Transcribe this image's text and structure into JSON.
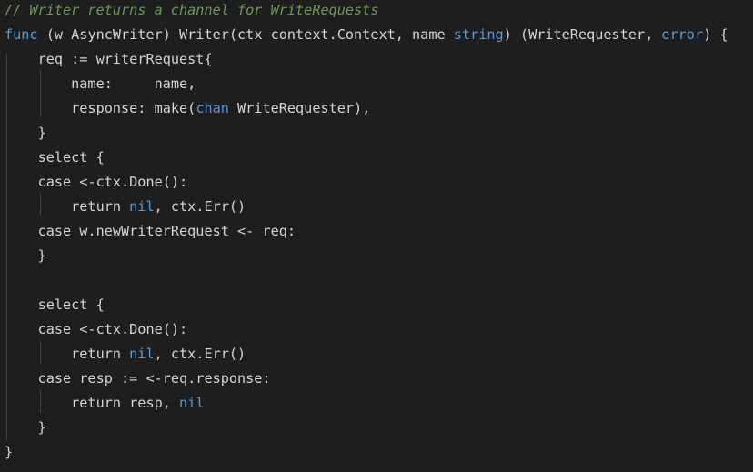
{
  "editor": {
    "language": "go",
    "colors": {
      "background": "#1e1e1e",
      "text": "#d4d4d4",
      "keyword": "#569cd6",
      "comment": "#6a9955",
      "indent_guide": "#404040"
    },
    "lines": [
      [
        {
          "t": "// Writer returns a channel for WriteRequests",
          "k": "comment"
        }
      ],
      [
        {
          "t": "func",
          "k": "keyword"
        },
        {
          "t": " (w AsyncWriter) Writer(ctx context.Context, name ",
          "k": "plain"
        },
        {
          "t": "string",
          "k": "builtin"
        },
        {
          "t": ") (WriteRequester, ",
          "k": "plain"
        },
        {
          "t": "error",
          "k": "builtin"
        },
        {
          "t": ") {",
          "k": "plain"
        }
      ],
      [
        {
          "t": "    req := writerRequest{",
          "k": "plain"
        }
      ],
      [
        {
          "t": "        name:     name,",
          "k": "plain"
        }
      ],
      [
        {
          "t": "        response: make(",
          "k": "plain"
        },
        {
          "t": "chan",
          "k": "keyword"
        },
        {
          "t": " WriteRequester),",
          "k": "plain"
        }
      ],
      [
        {
          "t": "    }",
          "k": "plain"
        }
      ],
      [
        {
          "t": "    select {",
          "k": "plain"
        }
      ],
      [
        {
          "t": "    case <-ctx.Done():",
          "k": "plain"
        }
      ],
      [
        {
          "t": "        return ",
          "k": "plain"
        },
        {
          "t": "nil",
          "k": "builtin"
        },
        {
          "t": ", ctx.Err()",
          "k": "plain"
        }
      ],
      [
        {
          "t": "    case w.newWriterRequest <- req:",
          "k": "plain"
        }
      ],
      [
        {
          "t": "    }",
          "k": "plain"
        }
      ],
      [
        {
          "t": "",
          "k": "plain"
        }
      ],
      [
        {
          "t": "    select {",
          "k": "plain"
        }
      ],
      [
        {
          "t": "    case <-ctx.Done():",
          "k": "plain"
        }
      ],
      [
        {
          "t": "        return ",
          "k": "plain"
        },
        {
          "t": "nil",
          "k": "builtin"
        },
        {
          "t": ", ctx.Err()",
          "k": "plain"
        }
      ],
      [
        {
          "t": "    case resp := <-req.response:",
          "k": "plain"
        }
      ],
      [
        {
          "t": "        return resp, ",
          "k": "plain"
        },
        {
          "t": "nil",
          "k": "builtin"
        }
      ],
      [
        {
          "t": "    }",
          "k": "plain"
        }
      ],
      [
        {
          "t": "}",
          "k": "plain"
        }
      ]
    ]
  }
}
